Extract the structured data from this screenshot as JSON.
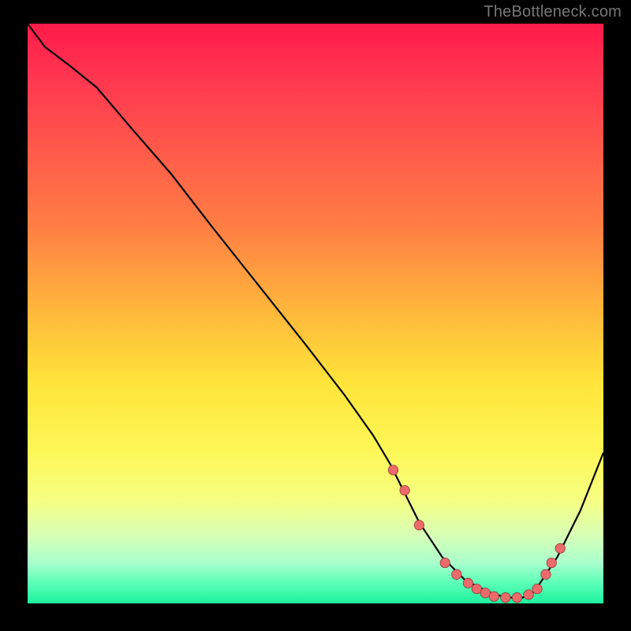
{
  "watermark": "TheBottleneck.com",
  "colors": {
    "background": "#000000",
    "curve": "#000000",
    "marker": "#ec6a6a",
    "marker_stroke": "#8f3a3a"
  },
  "gradient_stops": [
    {
      "offset": 0.0,
      "color": "#ff1a4a"
    },
    {
      "offset": 0.1,
      "color": "#ff3850"
    },
    {
      "offset": 0.22,
      "color": "#ff5a4a"
    },
    {
      "offset": 0.35,
      "color": "#ff7e44"
    },
    {
      "offset": 0.5,
      "color": "#ffb93b"
    },
    {
      "offset": 0.62,
      "color": "#ffe43a"
    },
    {
      "offset": 0.73,
      "color": "#fef654"
    },
    {
      "offset": 0.82,
      "color": "#f6ff80"
    },
    {
      "offset": 0.88,
      "color": "#d9ffb4"
    },
    {
      "offset": 0.93,
      "color": "#a9ffcd"
    },
    {
      "offset": 0.965,
      "color": "#5bffb7"
    },
    {
      "offset": 1.0,
      "color": "#1df29f"
    }
  ],
  "chart_data": {
    "type": "line",
    "title": "",
    "xlabel": "",
    "ylabel": "",
    "xlim": [
      0,
      100
    ],
    "ylim": [
      0,
      100
    ],
    "series": [
      {
        "name": "bottleneck-curve",
        "x": [
          0,
          3,
          7,
          12,
          18,
          25,
          32,
          40,
          48,
          55,
          60,
          63,
          65,
          68,
          72,
          76,
          80,
          83,
          86,
          88,
          92,
          96,
          100
        ],
        "y": [
          100,
          96,
          93,
          89,
          82,
          74,
          65,
          55,
          45,
          36,
          29,
          24,
          20,
          14,
          8,
          4,
          2,
          1,
          1,
          2,
          8,
          16,
          26
        ]
      }
    ],
    "markers": {
      "name": "highlight-points",
      "x": [
        63.5,
        65.5,
        68.0,
        72.5,
        74.5,
        76.5,
        78.0,
        79.5,
        81.0,
        83.0,
        85.0,
        87.0,
        88.5,
        90.0,
        91.0,
        92.5
      ],
      "y": [
        23.0,
        19.5,
        13.5,
        7.0,
        5.0,
        3.5,
        2.5,
        1.8,
        1.2,
        1.0,
        1.0,
        1.5,
        2.5,
        5.0,
        7.0,
        9.5
      ]
    }
  }
}
